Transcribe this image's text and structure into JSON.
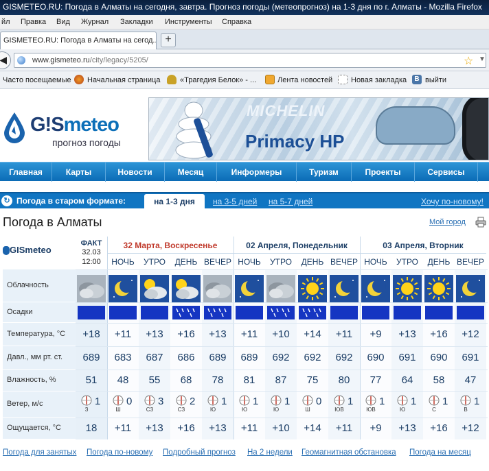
{
  "window": {
    "title": "GISMETEO.RU: Погода в Алматы на сегодня, завтра. Прогноз погоды (метеопрогноз) на 1-3 дня по г. Алматы - Mozilla Firefox"
  },
  "menu": [
    "йл",
    "Правка",
    "Вид",
    "Журнал",
    "Закладки",
    "Инструменты",
    "Справка"
  ],
  "tab": {
    "label": "GISMETEO.RU: Погода в Алматы на сегод...",
    "new_tab": "+"
  },
  "address": {
    "domain": "www.gismeteo.ru",
    "path": "/city/legacy/5205/"
  },
  "bookmarks": [
    "Часто посещаемые",
    "Начальная страница",
    "«Трагедия Белок» - ...",
    "Лента новостей",
    "Новая закладка",
    "выйти"
  ],
  "site": {
    "logo": "G!Smeteo",
    "logo_prefix": "G!S",
    "logo_suffix": "meteo",
    "tagline": "прогноз погоды"
  },
  "banner": {
    "brand": "MICHELIN",
    "model": "Primacy HP"
  },
  "nav": [
    "Главная",
    "Карты",
    "Новости",
    "Месяц",
    "Информеры",
    "Туризм",
    "Проекты",
    "Сервисы"
  ],
  "format_bar": {
    "label": "Погода в старом формате:",
    "active_tab": "на 1-3 дня",
    "links": [
      "на 3-5 дней",
      "на 5-7 дней"
    ],
    "new_format": "Хочу по-новому!"
  },
  "page": {
    "title": "Погода в Алматы",
    "my_city": "Мой город"
  },
  "forecast": {
    "logo": "GISmeteo",
    "fact": {
      "label": "ФАКТ",
      "date": "32.03",
      "time": "12:00"
    },
    "days": [
      {
        "label": "32 Марта, Воскресенье",
        "color": "#c0392b"
      },
      {
        "label": "02 Апреля, Понедельник",
        "color": "#1c3e66"
      },
      {
        "label": "03 Апреля, Вторник",
        "color": "#1c3e66"
      }
    ],
    "periods": [
      "НОЧЬ",
      "УТРО",
      "ДЕНЬ",
      "ВЕЧЕР",
      "НОЧЬ",
      "УТРО",
      "ДЕНЬ",
      "ВЕЧЕР",
      "НОЧЬ",
      "УТРО",
      "ДЕНЬ",
      "ВЕЧЕР"
    ],
    "row_labels": [
      "Облачность",
      "Осадки",
      "Температура, °С",
      "Давл., мм рт. ст.",
      "Влажность, %",
      "Ветер, м/с",
      "Ощущается, °С"
    ],
    "icons": [
      "cloudy",
      "night-clear",
      "sun-cloud",
      "sun-cloud",
      "cloudy",
      "night-clear",
      "cloudy",
      "sun",
      "night-clear",
      "night-clear",
      "sun",
      "sun",
      "night-clear"
    ],
    "precip": [
      "none",
      "none",
      "none",
      "rain",
      "rain",
      "none",
      "rain",
      "rain",
      "none",
      "none",
      "none",
      "none",
      "none"
    ],
    "temperature": [
      "+18",
      "+11",
      "+13",
      "+16",
      "+13",
      "+11",
      "+10",
      "+14",
      "+11",
      "+9",
      "+13",
      "+16",
      "+12"
    ],
    "pressure": [
      "689",
      "683",
      "687",
      "686",
      "689",
      "689",
      "692",
      "692",
      "692",
      "690",
      "691",
      "690",
      "691"
    ],
    "humidity": [
      "51",
      "48",
      "55",
      "68",
      "78",
      "81",
      "87",
      "75",
      "80",
      "77",
      "64",
      "58",
      "47"
    ],
    "wind_dir": [
      "З",
      "Ш",
      "СЗ",
      "СЗ",
      "Ю",
      "Ю",
      "Ю",
      "Ш",
      "ЮВ",
      "ЮВ",
      "Ю",
      "С",
      "В"
    ],
    "wind_speed": [
      "1",
      "0",
      "3",
      "2",
      "1",
      "1",
      "1",
      "0",
      "1",
      "1",
      "1",
      "1",
      "1"
    ],
    "feels_like": [
      "18",
      "+11",
      "+13",
      "+16",
      "+13",
      "+11",
      "+10",
      "+14",
      "+11",
      "+9",
      "+13",
      "+16",
      "+12"
    ]
  },
  "bottom_links": [
    "Погода для занятых",
    "Погода по-новому",
    "Подробный прогноз",
    "На 2 недели",
    "Геомагнитная обстановка",
    "Погода на месяц"
  ]
}
